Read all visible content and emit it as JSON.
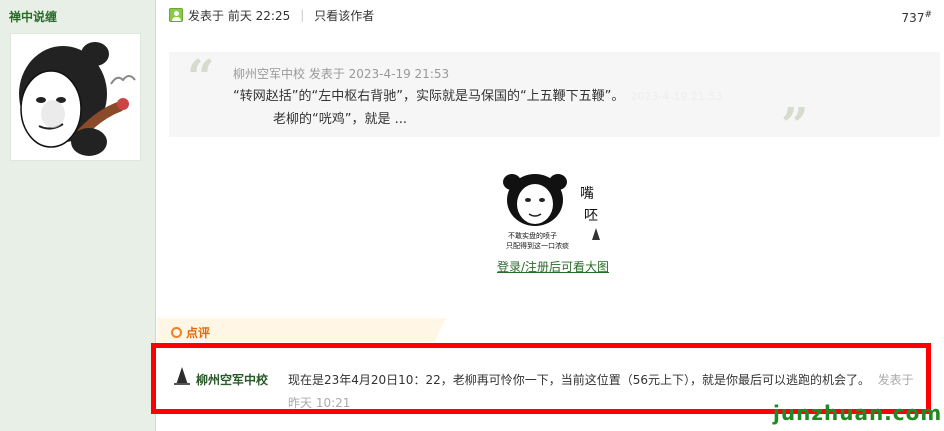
{
  "sidebar": {
    "author_name": "禅中说缠"
  },
  "post": {
    "posted_label": "发表于 前天 22:25",
    "only_author": "只看该作者",
    "floor": "737",
    "floor_suffix": "#"
  },
  "quote": {
    "meta": "柳州空军中校 发表于 2023-4-19 21:53",
    "line1": "“转网赵括”的“左中枢右背驰”，实际就是马保国的“上五鞭下五鞭”。",
    "line1_ghost": "2023-4-19 21:53",
    "line2": "老柳的“咣鸡”，就是 ..."
  },
  "image": {
    "caption": "登录/注册后可看大图",
    "text_big1": "嘴",
    "text_big2": "呸",
    "text_small1": "不敢实盘的喷子",
    "text_small2": "只配得到这一口浓痰"
  },
  "comments": {
    "label": "点评",
    "items": [
      {
        "user": "柳州空军中校",
        "text": "现在是23年4月20日10：22，老柳再可怜你一下，当前这位置（56元上下），就是你最后可以逃跑的机会了。",
        "time": "发表于 昨天 10:21"
      }
    ]
  },
  "watermark": "junzhuan.com"
}
